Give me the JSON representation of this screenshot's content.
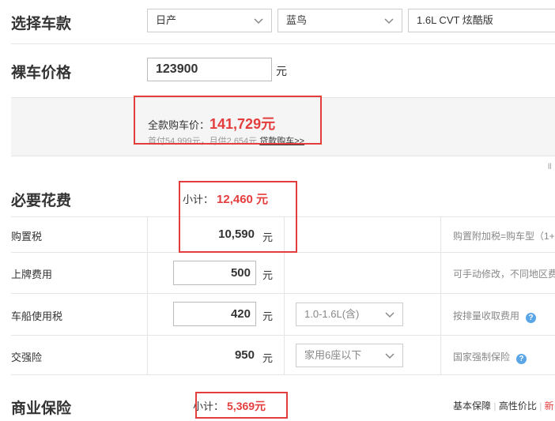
{
  "select_car": {
    "title": "选择车款",
    "brand": "日产",
    "series": "蓝鸟",
    "model": "1.6L CVT 炫酷版"
  },
  "bare_price": {
    "title": "裸车价格",
    "value": "123900",
    "unit": "元"
  },
  "summary": {
    "full_label": "全款购车价：",
    "full_value": "141,729元",
    "loan_text": "首付54,999元，月供2,654元",
    "loan_link": "贷款购车>>",
    "edge_mark": "ll"
  },
  "required": {
    "title": "必要花费",
    "subtotal_label": "小计：",
    "subtotal_value": "12,460 元",
    "rows": [
      {
        "label": "购置税",
        "value": "10,590",
        "unit": "元",
        "note": "购置附加税=购车型（1+"
      },
      {
        "label": "上牌费用",
        "value": "500",
        "unit": "元",
        "note": "可手动修改，不同地区费"
      },
      {
        "label": "车船使用税",
        "value": "420",
        "unit": "元",
        "select": "1.0-1.6L(含)",
        "note": "按排量收取费用"
      },
      {
        "label": "交强险",
        "value": "950",
        "unit": "元",
        "select": "家用6座以下",
        "note": "国家强制保险"
      }
    ],
    "help_glyph": "?"
  },
  "insurance": {
    "title": "商业保险",
    "subtotal_label": "小计：",
    "subtotal_value": "5,369元",
    "options": [
      "基本保障",
      "高性价比",
      "新"
    ],
    "separator": "|"
  },
  "colors": {
    "accent_red": "#e43d3d",
    "help_blue": "#5aa6e6"
  },
  "icons": {
    "dropdown": "chevron-down-icon",
    "help": "question-circle-icon"
  }
}
